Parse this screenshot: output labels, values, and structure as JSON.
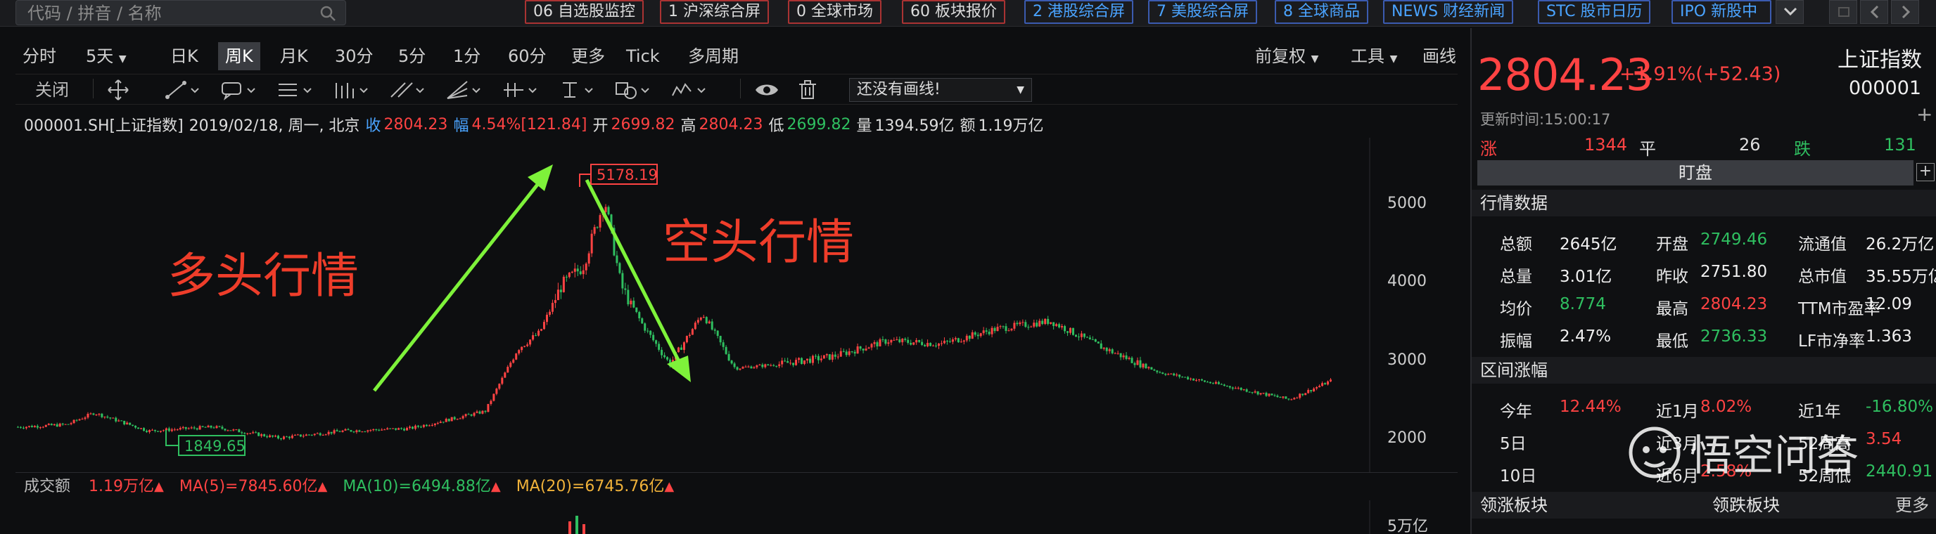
{
  "search": {
    "placeholder": "代码 / 拼音 / 名称"
  },
  "quick_tabs": [
    {
      "label": "06 自选股监控"
    },
    {
      "label": "1 沪深综合屏"
    },
    {
      "label": "0 全球市场"
    },
    {
      "label": "60 板块报价"
    },
    {
      "label": "2 港股综合屏"
    },
    {
      "label": "7 美股综合屏"
    },
    {
      "label": "8 全球商品"
    },
    {
      "label": "NEWS 财经新闻"
    },
    {
      "label": "STC 股市日历"
    },
    {
      "label": "IPO 新股中"
    }
  ],
  "periods": [
    "分时",
    "5天",
    "日K",
    "周K",
    "月K",
    "30分",
    "5分",
    "1分",
    "60分",
    "更多",
    "Tick",
    "多周期"
  ],
  "active_period": "周K",
  "right_menu": [
    "前复权",
    "工具",
    "画线"
  ],
  "draw_toolbar": {
    "close_label": "关闭",
    "line_select": "还没有画线!"
  },
  "infoline": {
    "code": "000001.SH[上证指数]",
    "date": "2019/02/18, 周一, 北京",
    "close_label": "收",
    "close": "2804.23",
    "amp_label": "幅",
    "amp": "4.54%",
    "amp_pts": "[121.84]",
    "open_label": "开",
    "open": "2699.82",
    "high_label": "高",
    "high": "2804.23",
    "low_label": "低",
    "low": "2699.82",
    "vol_label": "量",
    "vol": "1394.59亿",
    "amt_label": "额",
    "amt": "1.19万亿"
  },
  "chart": {
    "annotation_bull": "多头行情",
    "annotation_bear": "空头行情",
    "peak_label": "5178.19",
    "trough_label": "1849.65",
    "y_ticks": [
      "5000",
      "4000",
      "3000",
      "2000"
    ],
    "vol_tick": "5万亿"
  },
  "volume_bar": {
    "label": "成交额",
    "amount": "1.19万亿",
    "ma5": "MA(5)=7845.60亿",
    "ma10": "MA(10)=6494.88亿",
    "ma20": "MA(20)=6745.76亿"
  },
  "quote": {
    "price": "2804.23",
    "change": "+1.91%(+52.43)",
    "name": "上证指数",
    "code": "000001",
    "update_time": "更新时间:15:00:17",
    "up_label": "涨",
    "up_count": "1344",
    "flat_label": "平",
    "flat_count": "26",
    "down_label": "跌",
    "down_count": "131",
    "watch_label": "盯盘"
  },
  "market_data": {
    "title": "行情数据",
    "rows": [
      [
        {
          "k": "总额",
          "v": "2645亿",
          "c": "white"
        },
        {
          "k": "开盘",
          "v": "2749.46",
          "c": "green"
        },
        {
          "k": "流通值",
          "v": "26.2万亿",
          "c": "white"
        }
      ],
      [
        {
          "k": "总量",
          "v": "3.01亿",
          "c": "white"
        },
        {
          "k": "昨收",
          "v": "2751.80",
          "c": "white"
        },
        {
          "k": "总市值",
          "v": "35.55万亿",
          "c": "white"
        }
      ],
      [
        {
          "k": "均价",
          "v": "8.774",
          "c": "green"
        },
        {
          "k": "最高",
          "v": "2804.23",
          "c": "red"
        },
        {
          "k": "TTM市盈率",
          "v": "12.09",
          "c": "white"
        }
      ],
      [
        {
          "k": "振幅",
          "v": "2.47%",
          "c": "white"
        },
        {
          "k": "最低",
          "v": "2736.33",
          "c": "green"
        },
        {
          "k": "LF市净率",
          "v": "1.363",
          "c": "white"
        }
      ]
    ]
  },
  "range_change": {
    "title": "区间涨幅",
    "rows": [
      [
        {
          "k": "今年",
          "v": "12.44%",
          "c": "red"
        },
        {
          "k": "近1月",
          "v": "8.02%",
          "c": "red"
        },
        {
          "k": "近1年",
          "v": "-16.80%",
          "c": "green"
        }
      ],
      [
        {
          "k": "5日",
          "v": "",
          "c": "red"
        },
        {
          "k": "近3月",
          "v": "",
          "c": "red"
        },
        {
          "k": "52周高",
          "v": "3.54",
          "c": "red"
        }
      ],
      [
        {
          "k": "10日",
          "v": "",
          "c": "red"
        },
        {
          "k": "近6月",
          "v": "2.58%",
          "c": "red"
        },
        {
          "k": "52周低",
          "v": "2440.91",
          "c": "green"
        }
      ]
    ]
  },
  "boards": {
    "lead_up": "领涨板块",
    "lead_down": "领跌板块",
    "more": "更多"
  },
  "watermark": "悟空问答",
  "colors": {
    "up": "#ff4343",
    "down": "#2fbf60",
    "accent_arrow": "#7ef23a",
    "bg": "#0d0e10"
  }
}
